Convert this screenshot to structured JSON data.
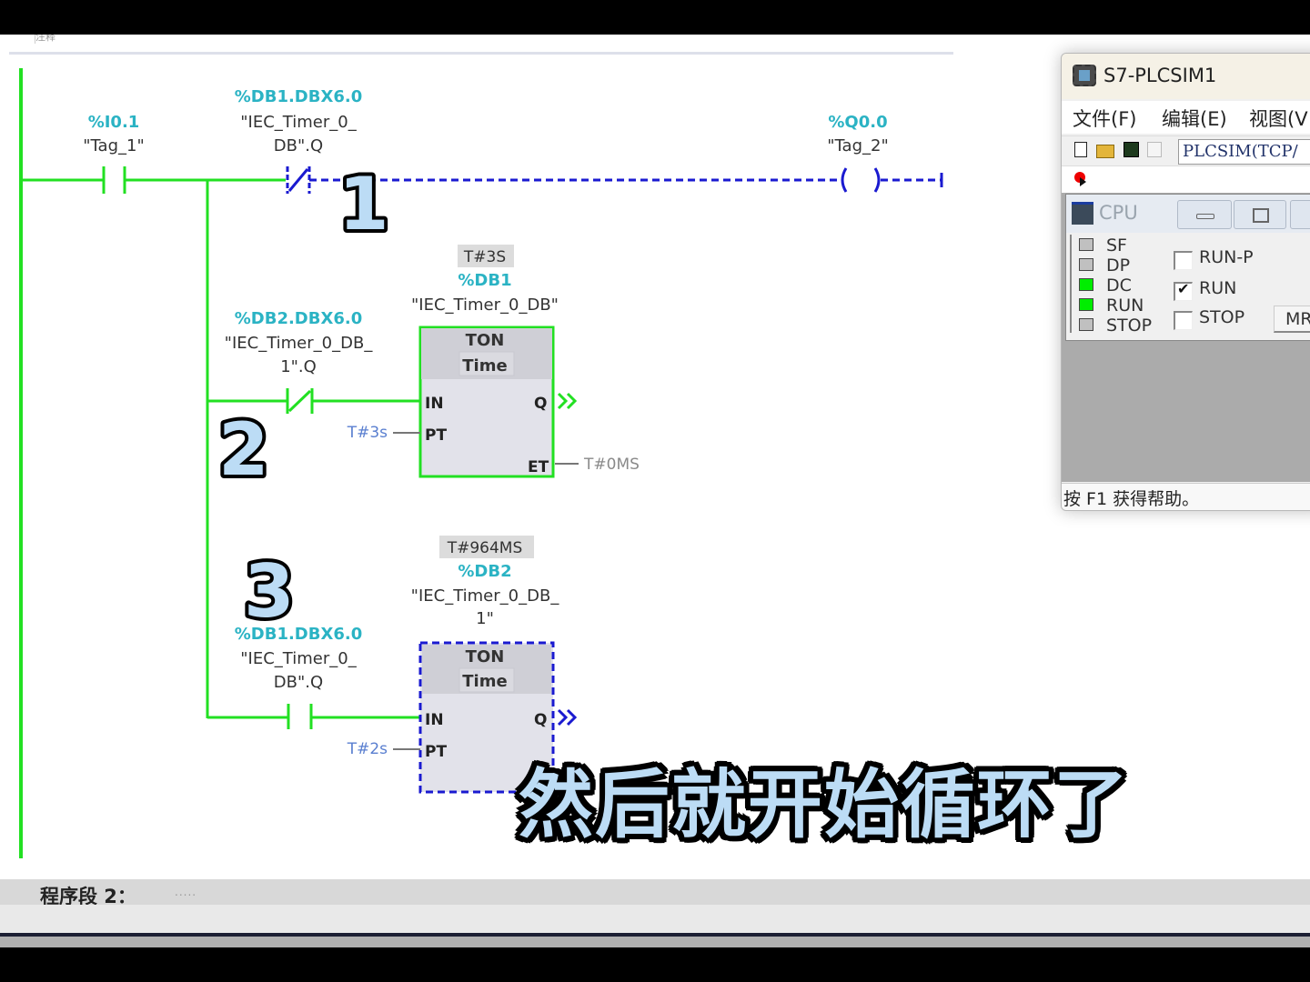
{
  "editor": {
    "comment_stub": "注释",
    "network1": {
      "rungs": [
        {
          "id": 1,
          "contacts": [
            {
              "type": "NO",
              "address": "%I0.1",
              "symbol_line1": "\"Tag_1\"",
              "symbol_line2": "",
              "state": "energized"
            },
            {
              "type": "NC",
              "address": "%DB1.DBX6.0",
              "symbol_line1": "\"IEC_Timer_0_",
              "symbol_line2": "DB\".Q",
              "state": "not-energized"
            }
          ],
          "coil": {
            "address": "%Q0.0",
            "symbol": "\"Tag_2\"",
            "state": "not-energized"
          }
        },
        {
          "id": 2,
          "contact": {
            "type": "NC",
            "address": "%DB2.DBX6.0",
            "symbol_line1": "\"IEC_Timer_0_DB_",
            "symbol_line2": "1\".Q",
            "state": "energized"
          },
          "timer": {
            "current_value": "T#3S",
            "instance_address": "%DB1",
            "instance_symbol_line1": "\"IEC_Timer_0_DB\"",
            "instance_symbol_line2": "",
            "type": "TON",
            "data_type": "Time",
            "pins": {
              "in": "IN",
              "pt": "PT",
              "q": "Q",
              "et": "ET"
            },
            "pt_value": "T#3s",
            "et_value": "T#0MS",
            "state": "energized"
          }
        },
        {
          "id": 3,
          "contact": {
            "type": "NO",
            "address": "%DB1.DBX6.0",
            "symbol_line1": "\"IEC_Timer_0_",
            "symbol_line2": "DB\".Q",
            "state": "energized"
          },
          "timer": {
            "current_value": "T#964MS",
            "instance_address": "%DB2",
            "instance_symbol_line1": "\"IEC_Timer_0_DB_",
            "instance_symbol_line2": "1\"",
            "type": "TON",
            "data_type": "Time",
            "pins": {
              "in": "IN",
              "pt": "PT",
              "q": "Q"
            },
            "pt_value": "T#2s",
            "state": "not-energized"
          }
        }
      ],
      "annotation_numbers": [
        "1",
        "2",
        "3"
      ]
    },
    "network2": {
      "label": "程序段 2：",
      "comment": "....."
    }
  },
  "colors": {
    "energized": "#22e022",
    "not_energized": "#1a1ad0",
    "address": "#2bb3c4",
    "param_in": "#5a7fd0",
    "subtitle_fill": "#bcdcf5"
  },
  "subtitle": "然后就开始循环了",
  "plcsim": {
    "title": "S7-PLCSIM1",
    "menu": [
      "文件(F)",
      "编辑(E)",
      "视图(V"
    ],
    "toolbar_icons": [
      "new-file-icon",
      "open-folder-icon",
      "save-icon",
      "print-icon"
    ],
    "connection_value": "PLCSIM(TCP/",
    "cpu_window": {
      "title": "CPU",
      "leds": [
        {
          "label": "SF",
          "on": false
        },
        {
          "label": "DP",
          "on": false
        },
        {
          "label": "DC",
          "on": true
        },
        {
          "label": "RUN",
          "on": true
        },
        {
          "label": "STOP",
          "on": false
        }
      ],
      "modes": [
        {
          "label": "RUN-P",
          "checked": false
        },
        {
          "label": "RUN",
          "checked": true
        },
        {
          "label": "STOP",
          "checked": false
        }
      ],
      "mres_label": "MRES",
      "check_mark": "✔"
    },
    "status_text": "按 F1 获得帮助。"
  }
}
